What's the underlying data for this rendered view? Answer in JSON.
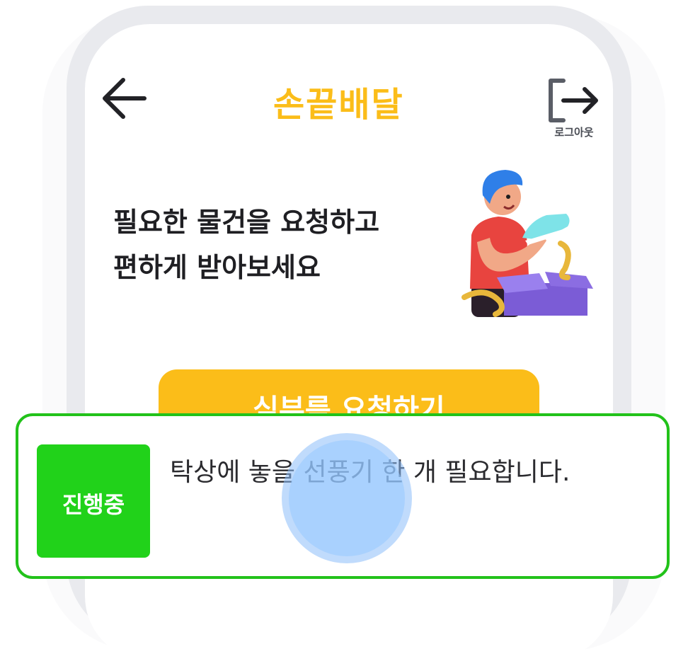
{
  "header": {
    "title": "손끝배달",
    "logout_label": "로그아웃"
  },
  "hero": {
    "line1": "필요한 물건을 요청하고",
    "line2": "편하게 받아보세요"
  },
  "cta": {
    "label": "심부름 요청하기"
  },
  "request_card": {
    "status": "진행중",
    "message": "탁상에 놓을 선풍기 한 개 필요합니다."
  },
  "colors": {
    "brand": "#fbbd19",
    "status_green": "#21d21a",
    "card_border": "#22c21a"
  },
  "icons": {
    "back": "arrow-left-icon",
    "logout": "logout-icon",
    "illustration": "person-with-shoe-and-box-illustration"
  }
}
